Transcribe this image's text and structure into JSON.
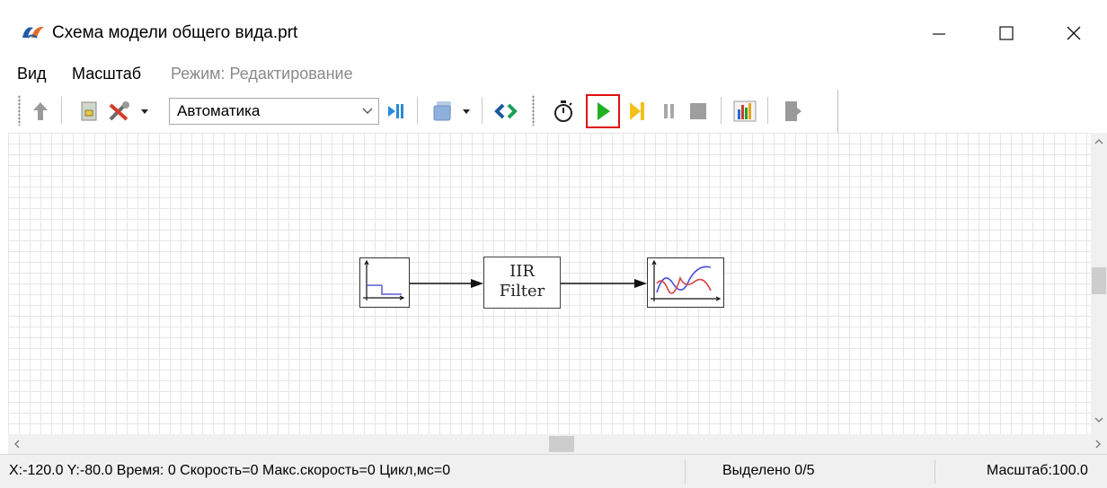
{
  "window": {
    "title": "Схема модели общего вида.prt"
  },
  "menu": {
    "view": "Вид",
    "scale": "Масштаб",
    "mode": "Режим: Редактирование"
  },
  "toolbar": {
    "combo_value": "Автоматика",
    "highlight_color": "#e01010",
    "icons": [
      "up-arrow-icon",
      "script-icon",
      "tools-icon",
      "dropdown-arrow-icon",
      "step-into-icon",
      "layers-icon",
      "dropdown-arrow-icon",
      "link-icon",
      "stopwatch-icon",
      "play-icon",
      "step-icon",
      "pause-icon",
      "stop-icon",
      "bar-chart-icon",
      "exit-icon"
    ]
  },
  "diagram": {
    "filter_line1": "IIR",
    "filter_line2": "Filter",
    "blocks": [
      "step-source-block",
      "iir-filter-block",
      "scope-block"
    ]
  },
  "status": {
    "coords": "X:-120.0  Y:-80.0 Время: 0 Скорость=0 Макс.скорость=0 Цикл,мс=0",
    "selected": "Выделено 0/5",
    "zoom": "Масштаб:100.0"
  }
}
